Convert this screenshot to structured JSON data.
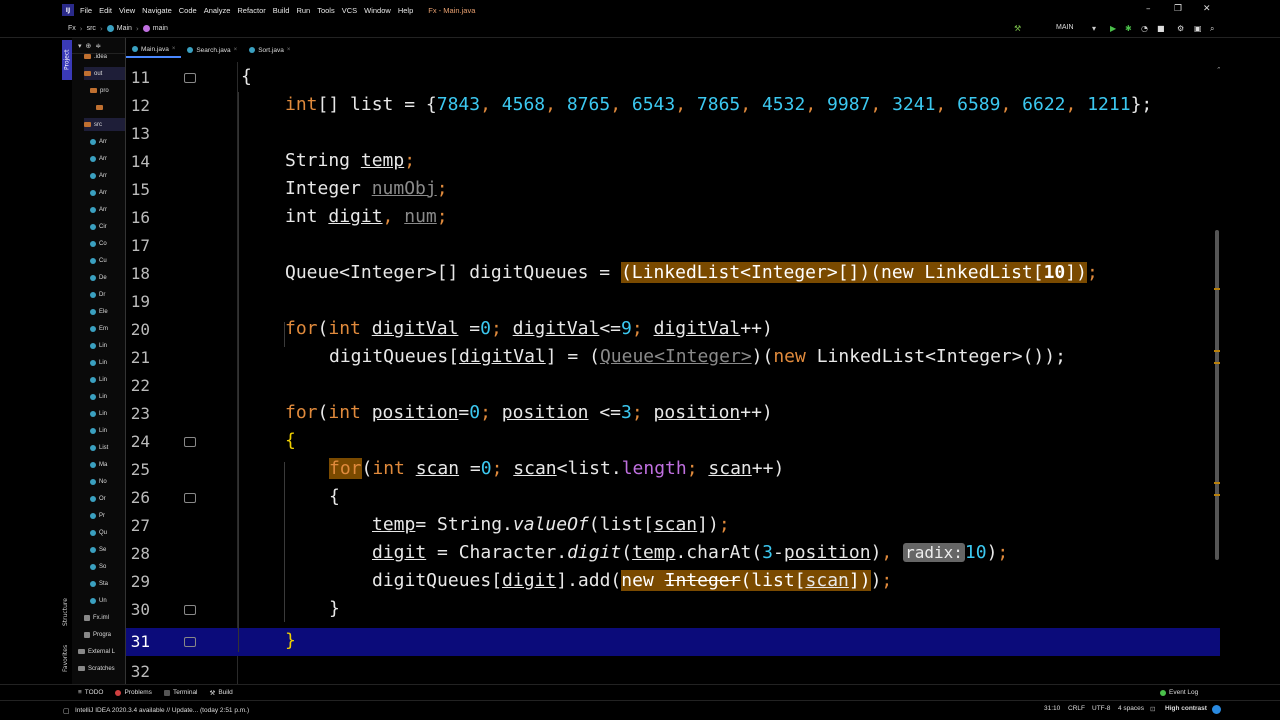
{
  "menu": {
    "items": [
      "File",
      "Edit",
      "View",
      "Navigate",
      "Code",
      "Analyze",
      "Refactor",
      "Build",
      "Run",
      "Tools",
      "VCS",
      "Window",
      "Help"
    ],
    "window_title": "Fx - Main.java"
  },
  "navbar": {
    "crumbs": [
      "Fx",
      "src",
      "Main",
      "main"
    ],
    "run_config": "MAIN"
  },
  "project": {
    "tree": [
      {
        "label": ".idea",
        "kind": "folder",
        "depth": 1
      },
      {
        "label": "out",
        "kind": "folder",
        "depth": 1
      },
      {
        "label": "pro",
        "kind": "folder",
        "depth": 2
      },
      {
        "label": "",
        "kind": "folder",
        "depth": 3
      },
      {
        "label": "src",
        "kind": "folder",
        "depth": 1
      },
      {
        "label": "Arr",
        "kind": "class",
        "depth": 2
      },
      {
        "label": "Arr",
        "kind": "class",
        "depth": 2
      },
      {
        "label": "Arr",
        "kind": "class",
        "depth": 2
      },
      {
        "label": "Arr",
        "kind": "class",
        "depth": 2
      },
      {
        "label": "Arr",
        "kind": "class",
        "depth": 2
      },
      {
        "label": "Cir",
        "kind": "class",
        "depth": 2
      },
      {
        "label": "Co",
        "kind": "class",
        "depth": 2
      },
      {
        "label": "Cu",
        "kind": "class",
        "depth": 2
      },
      {
        "label": "De",
        "kind": "class",
        "depth": 2
      },
      {
        "label": "Dr",
        "kind": "class",
        "depth": 2
      },
      {
        "label": "Ele",
        "kind": "class",
        "depth": 2
      },
      {
        "label": "Em",
        "kind": "class",
        "depth": 2
      },
      {
        "label": "Lin",
        "kind": "class",
        "depth": 2
      },
      {
        "label": "Lin",
        "kind": "class",
        "depth": 2
      },
      {
        "label": "Lin",
        "kind": "class",
        "depth": 2
      },
      {
        "label": "Lin",
        "kind": "class",
        "depth": 2
      },
      {
        "label": "Lin",
        "kind": "class",
        "depth": 2
      },
      {
        "label": "Lin",
        "kind": "class",
        "depth": 2
      },
      {
        "label": "List",
        "kind": "class",
        "depth": 2
      },
      {
        "label": "Ma",
        "kind": "class",
        "depth": 2
      },
      {
        "label": "No",
        "kind": "class",
        "depth": 2
      },
      {
        "label": "Or",
        "kind": "class",
        "depth": 2
      },
      {
        "label": "Pr",
        "kind": "class",
        "depth": 2
      },
      {
        "label": "Qu",
        "kind": "class",
        "depth": 2
      },
      {
        "label": "Se",
        "kind": "class",
        "depth": 2
      },
      {
        "label": "So",
        "kind": "class",
        "depth": 2
      },
      {
        "label": "Sta",
        "kind": "class",
        "depth": 2
      },
      {
        "label": "Un",
        "kind": "class",
        "depth": 2
      },
      {
        "label": "Fx.iml",
        "kind": "file",
        "depth": 1
      },
      {
        "label": "Progra",
        "kind": "file",
        "depth": 1
      },
      {
        "label": "External L",
        "kind": "lib",
        "depth": 0
      },
      {
        "label": "Scratches",
        "kind": "lib",
        "depth": 0
      }
    ],
    "stripe_project": "Project",
    "stripe_structure": "Structure",
    "stripe_favorites": "Favorites"
  },
  "tabs": [
    {
      "label": "Main.java",
      "active": true
    },
    {
      "label": "Search.java",
      "active": false
    },
    {
      "label": "Sort.java",
      "active": false
    }
  ],
  "editor": {
    "inspection_count": "10",
    "line_numbers": [
      "11",
      "12",
      "13",
      "14",
      "15",
      "16",
      "17",
      "18",
      "19",
      "20",
      "21",
      "22",
      "23",
      "24",
      "25",
      "26",
      "27",
      "28",
      "29",
      "30",
      "31",
      "32"
    ],
    "current_line": "31",
    "list_values": [
      "7843",
      "4568",
      "8765",
      "6543",
      "7865",
      "4532",
      "9987",
      "3241",
      "6589",
      "6622",
      "1211"
    ],
    "radix_hint": "radix:",
    "radix_value": "10",
    "tokens": {
      "l12_type": "int",
      "l12_text": "[] list = {",
      "l12_end": "};",
      "l14_type": "String ",
      "l14_var": "temp",
      "l15_type": "Integer ",
      "l15_var": "numObj",
      "l16_type": "int",
      "l16_var1": "digit",
      "l16_var2": "num",
      "l18_text": "Queue<Integer>[] digitQueues = ",
      "l18_cast": "(LinkedList<Integer>[])(new LinkedList[",
      "l18_num": "10",
      "l18_close": "])",
      "l20_for": "for",
      "l20_int": "int",
      "l20_var": "digitVal",
      "l21_lhs": "digitQueues[",
      "l21_var": "digitVal",
      "l21_mid": "] = (",
      "l21_cast": "Queue<Integer>",
      "l21_new": "new",
      "l21_rest": " LinkedList<Integer>());",
      "l23_var": "position",
      "l25_var": "scan",
      "l25_list": "list.",
      "l25_len": "length",
      "l27_var": "temp",
      "l27_rest": "= String.",
      "l27_fn": "valueOf",
      "l27_arg": "(list[",
      "l28_var": "digit",
      "l28_rest": " = Character.",
      "l28_fn": "digit",
      "l28_chr": ".charAt(",
      "l28_num": "3",
      "l29_lhs": "digitQueues[",
      "l29_add": "].add(",
      "l29_new": "new ",
      "l29_int": "Integer",
      "l29_list": "(list[",
      "brace_open": "{",
      "brace_close": "}"
    }
  },
  "bottom_tools": [
    "TODO",
    "Problems",
    "Terminal",
    "Build"
  ],
  "event_log": "Event Log",
  "status": {
    "message": "IntelliJ IDEA 2020.3.4 available // Update... (today 2:51 p.m.)",
    "position": "31:10",
    "line_sep": "CRLF",
    "encoding": "UTF-8",
    "indent": "4 spaces",
    "theme": "High contrast"
  },
  "colors": {
    "keyword": "#e08a3c",
    "number": "#3cc8f0",
    "highlight": "#7a4a00",
    "current_line": "#0b0b7a",
    "brace": "#f0d000"
  }
}
